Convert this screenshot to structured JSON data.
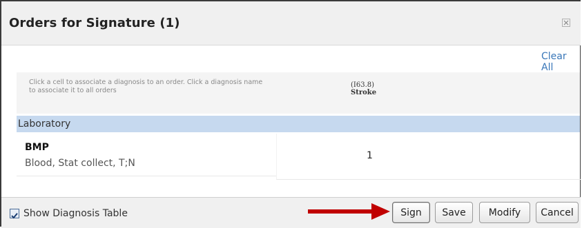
{
  "dialog": {
    "title": "Orders for Signature (1)",
    "clear_all_label": "Clear All"
  },
  "diagnosis_table": {
    "help_text": "Click a cell to associate a diagnosis to an order. Click a diagnosis name to associate it to all orders",
    "columns": [
      {
        "code": "(I63.8)",
        "name": "Stroke"
      }
    ]
  },
  "sections": [
    {
      "label": "Laboratory",
      "orders": [
        {
          "name": "BMP",
          "details": "Blood, Stat collect, T;N",
          "cells": [
            "1"
          ]
        }
      ]
    }
  ],
  "footer": {
    "show_diagnosis_table_label": "Show Diagnosis Table",
    "show_diagnosis_table_checked": true,
    "buttons": {
      "sign": "Sign",
      "save": "Save",
      "modify": "Modify",
      "cancel": "Cancel"
    }
  },
  "colors": {
    "accent_link": "#3876b8",
    "section_band": "#c6d9ef",
    "annotation_arrow": "#c00000"
  }
}
